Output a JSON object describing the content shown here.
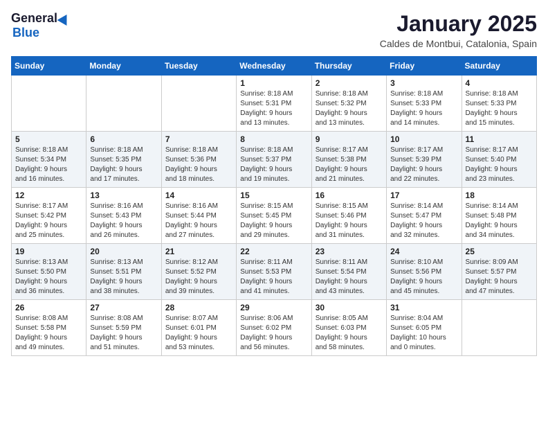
{
  "header": {
    "logo_general": "General",
    "logo_blue": "Blue",
    "month_title": "January 2025",
    "location": "Caldes de Montbui, Catalonia, Spain"
  },
  "days_of_week": [
    "Sunday",
    "Monday",
    "Tuesday",
    "Wednesday",
    "Thursday",
    "Friday",
    "Saturday"
  ],
  "weeks": [
    [
      {
        "day": "",
        "info": ""
      },
      {
        "day": "",
        "info": ""
      },
      {
        "day": "",
        "info": ""
      },
      {
        "day": "1",
        "info": "Sunrise: 8:18 AM\nSunset: 5:31 PM\nDaylight: 9 hours\nand 13 minutes."
      },
      {
        "day": "2",
        "info": "Sunrise: 8:18 AM\nSunset: 5:32 PM\nDaylight: 9 hours\nand 13 minutes."
      },
      {
        "day": "3",
        "info": "Sunrise: 8:18 AM\nSunset: 5:33 PM\nDaylight: 9 hours\nand 14 minutes."
      },
      {
        "day": "4",
        "info": "Sunrise: 8:18 AM\nSunset: 5:33 PM\nDaylight: 9 hours\nand 15 minutes."
      }
    ],
    [
      {
        "day": "5",
        "info": "Sunrise: 8:18 AM\nSunset: 5:34 PM\nDaylight: 9 hours\nand 16 minutes."
      },
      {
        "day": "6",
        "info": "Sunrise: 8:18 AM\nSunset: 5:35 PM\nDaylight: 9 hours\nand 17 minutes."
      },
      {
        "day": "7",
        "info": "Sunrise: 8:18 AM\nSunset: 5:36 PM\nDaylight: 9 hours\nand 18 minutes."
      },
      {
        "day": "8",
        "info": "Sunrise: 8:18 AM\nSunset: 5:37 PM\nDaylight: 9 hours\nand 19 minutes."
      },
      {
        "day": "9",
        "info": "Sunrise: 8:17 AM\nSunset: 5:38 PM\nDaylight: 9 hours\nand 21 minutes."
      },
      {
        "day": "10",
        "info": "Sunrise: 8:17 AM\nSunset: 5:39 PM\nDaylight: 9 hours\nand 22 minutes."
      },
      {
        "day": "11",
        "info": "Sunrise: 8:17 AM\nSunset: 5:40 PM\nDaylight: 9 hours\nand 23 minutes."
      }
    ],
    [
      {
        "day": "12",
        "info": "Sunrise: 8:17 AM\nSunset: 5:42 PM\nDaylight: 9 hours\nand 25 minutes."
      },
      {
        "day": "13",
        "info": "Sunrise: 8:16 AM\nSunset: 5:43 PM\nDaylight: 9 hours\nand 26 minutes."
      },
      {
        "day": "14",
        "info": "Sunrise: 8:16 AM\nSunset: 5:44 PM\nDaylight: 9 hours\nand 27 minutes."
      },
      {
        "day": "15",
        "info": "Sunrise: 8:15 AM\nSunset: 5:45 PM\nDaylight: 9 hours\nand 29 minutes."
      },
      {
        "day": "16",
        "info": "Sunrise: 8:15 AM\nSunset: 5:46 PM\nDaylight: 9 hours\nand 31 minutes."
      },
      {
        "day": "17",
        "info": "Sunrise: 8:14 AM\nSunset: 5:47 PM\nDaylight: 9 hours\nand 32 minutes."
      },
      {
        "day": "18",
        "info": "Sunrise: 8:14 AM\nSunset: 5:48 PM\nDaylight: 9 hours\nand 34 minutes."
      }
    ],
    [
      {
        "day": "19",
        "info": "Sunrise: 8:13 AM\nSunset: 5:50 PM\nDaylight: 9 hours\nand 36 minutes."
      },
      {
        "day": "20",
        "info": "Sunrise: 8:13 AM\nSunset: 5:51 PM\nDaylight: 9 hours\nand 38 minutes."
      },
      {
        "day": "21",
        "info": "Sunrise: 8:12 AM\nSunset: 5:52 PM\nDaylight: 9 hours\nand 39 minutes."
      },
      {
        "day": "22",
        "info": "Sunrise: 8:11 AM\nSunset: 5:53 PM\nDaylight: 9 hours\nand 41 minutes."
      },
      {
        "day": "23",
        "info": "Sunrise: 8:11 AM\nSunset: 5:54 PM\nDaylight: 9 hours\nand 43 minutes."
      },
      {
        "day": "24",
        "info": "Sunrise: 8:10 AM\nSunset: 5:56 PM\nDaylight: 9 hours\nand 45 minutes."
      },
      {
        "day": "25",
        "info": "Sunrise: 8:09 AM\nSunset: 5:57 PM\nDaylight: 9 hours\nand 47 minutes."
      }
    ],
    [
      {
        "day": "26",
        "info": "Sunrise: 8:08 AM\nSunset: 5:58 PM\nDaylight: 9 hours\nand 49 minutes."
      },
      {
        "day": "27",
        "info": "Sunrise: 8:08 AM\nSunset: 5:59 PM\nDaylight: 9 hours\nand 51 minutes."
      },
      {
        "day": "28",
        "info": "Sunrise: 8:07 AM\nSunset: 6:01 PM\nDaylight: 9 hours\nand 53 minutes."
      },
      {
        "day": "29",
        "info": "Sunrise: 8:06 AM\nSunset: 6:02 PM\nDaylight: 9 hours\nand 56 minutes."
      },
      {
        "day": "30",
        "info": "Sunrise: 8:05 AM\nSunset: 6:03 PM\nDaylight: 9 hours\nand 58 minutes."
      },
      {
        "day": "31",
        "info": "Sunrise: 8:04 AM\nSunset: 6:05 PM\nDaylight: 10 hours\nand 0 minutes."
      },
      {
        "day": "",
        "info": ""
      }
    ]
  ]
}
